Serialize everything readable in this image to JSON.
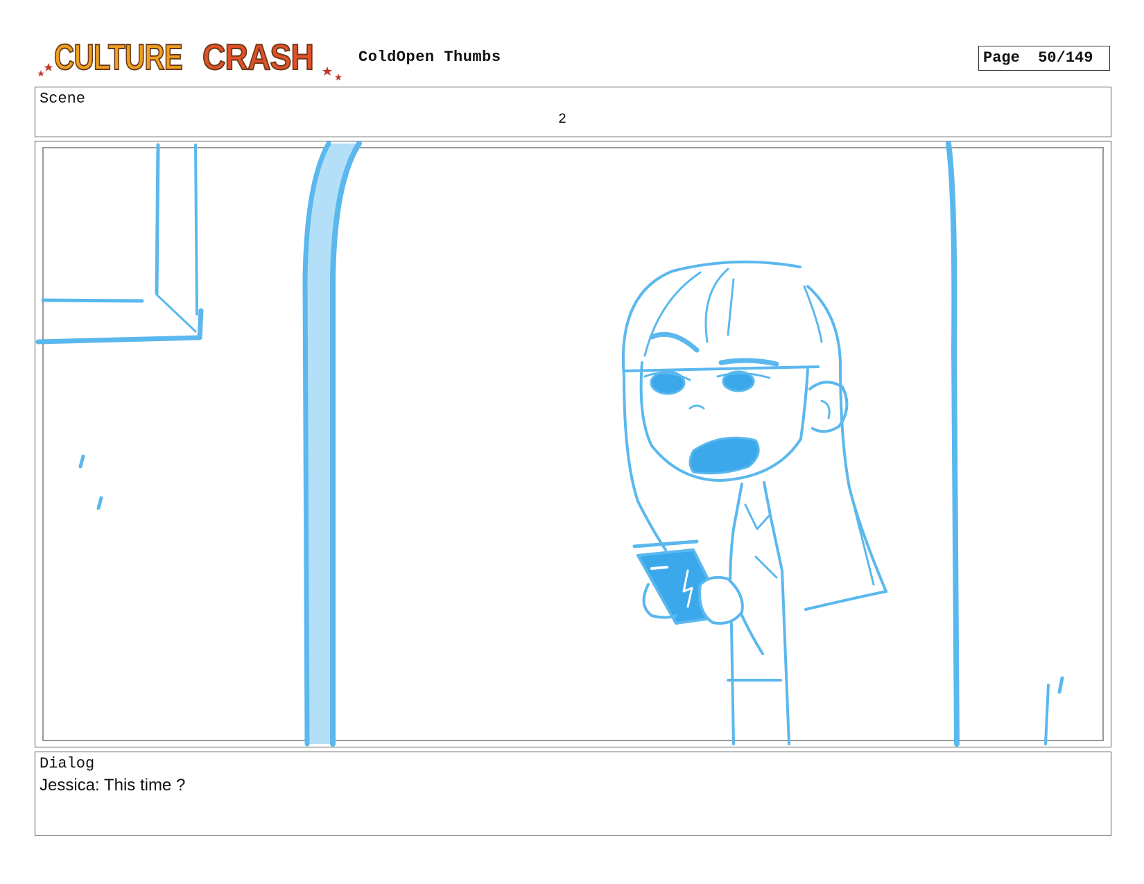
{
  "header": {
    "logo_text": "CULTURE CRASH",
    "title": "ColdOpen Thumbs",
    "page_label": "Page",
    "page_value": "50/149"
  },
  "scene": {
    "label": "Scene",
    "number": "2"
  },
  "panel": {
    "sketch_color": "#5bb8ee",
    "sketch_fill_light": "#b3e0f8",
    "sketch_fill_dark": "#3aa8ea"
  },
  "dialog": {
    "label": "Dialog",
    "text": "Jessica: This time ?"
  },
  "colors": {
    "logo_orange": "#f0a020",
    "logo_red": "#e0502a",
    "logo_outline": "#6b3a1a",
    "border": "#555555"
  }
}
